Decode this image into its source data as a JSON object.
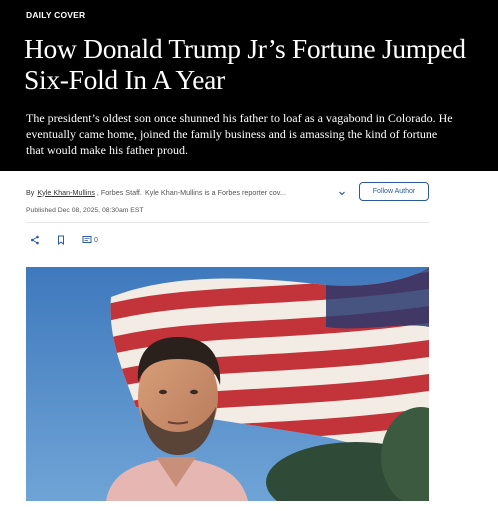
{
  "article": {
    "kicker": "DAILY COVER",
    "headline": "How Donald Trump Jr’s Fortune Jumped Six-Fold In A Year",
    "dek": "The president’s oldest son once shunned his father to loaf as a vagabond in Colorado. He eventually came home, joined the family business and is amassing the kind of fortune that would make his father proud."
  },
  "byline": {
    "prefix": "By",
    "author": "Kyle Khan-Mullins",
    "staff": ", Forbes Staff.",
    "bio": "Kyle Khan-Mullins is a Forbes reporter cov...",
    "follow_label": "Follow Author",
    "published": "Published Dec 08, 2025, 08:30am EST"
  },
  "actions": {
    "comment_count": "0"
  },
  "colors": {
    "hero_bg": "#000000",
    "accent": "#2c5aa0"
  },
  "icons": [
    "share-icon",
    "bookmark-icon",
    "comment-icon",
    "chevron-down-icon"
  ]
}
